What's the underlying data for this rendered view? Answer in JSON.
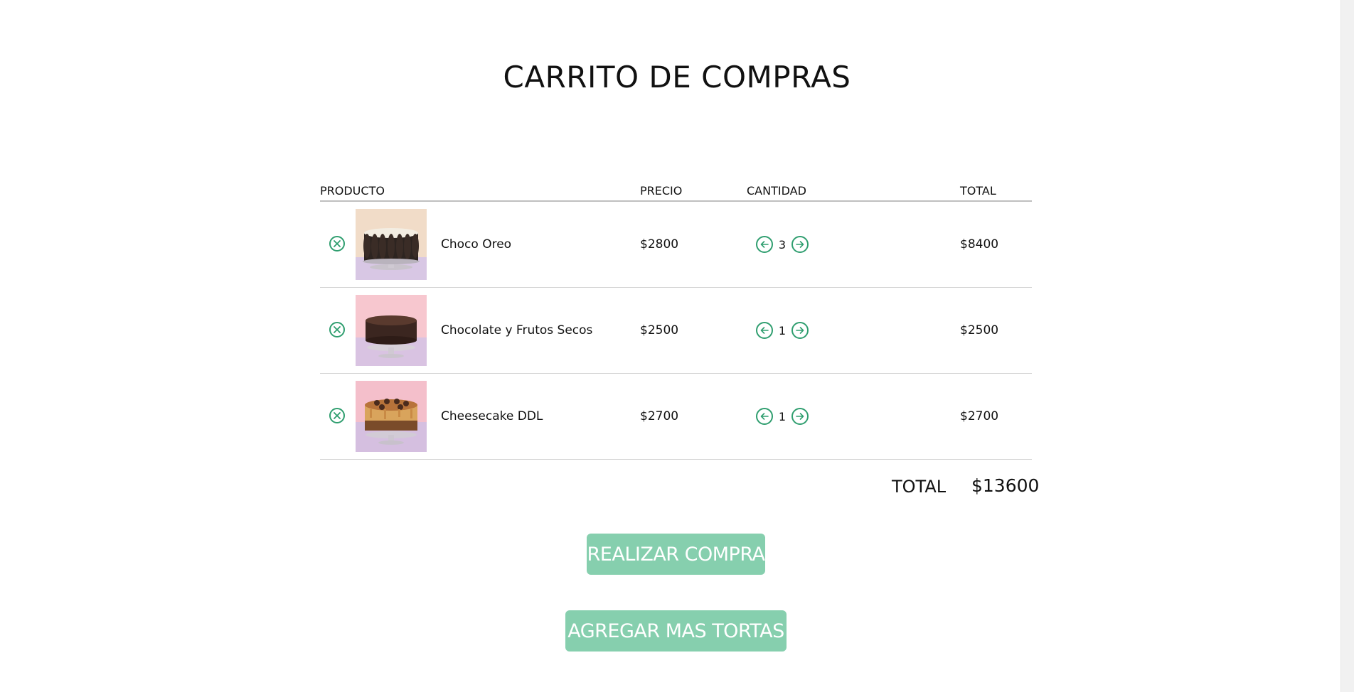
{
  "page": {
    "title": "CARRITO DE COMPRAS"
  },
  "table": {
    "headers": {
      "product": "PRODUCTO",
      "price": "PRECIO",
      "quantity": "CANTIDAD",
      "total": "TOTAL"
    },
    "rows": [
      {
        "name": "Choco Oreo",
        "price": "$2800",
        "quantity": "3",
        "total": "$8400",
        "image_icon": "cake-oreo"
      },
      {
        "name": "Chocolate y Frutos Secos",
        "price": "$2500",
        "quantity": "1",
        "total": "$2500",
        "image_icon": "cake-chocolate"
      },
      {
        "name": "Cheesecake DDL",
        "price": "$2700",
        "quantity": "1",
        "total": "$2700",
        "image_icon": "cake-cheesecake"
      }
    ]
  },
  "summary": {
    "label": "TOTAL",
    "value": "$13600"
  },
  "actions": {
    "checkout_label": "REALIZAR COMPRA",
    "add_more_label": "AGREGAR MAS TORTAS"
  },
  "colors": {
    "accent": "#2f9e6f",
    "button_bg": "#86cfae",
    "button_text": "#ffffff"
  },
  "icons": {
    "remove": "close-circle-icon",
    "decrease": "arrow-left-circle-icon",
    "increase": "arrow-right-circle-icon"
  }
}
